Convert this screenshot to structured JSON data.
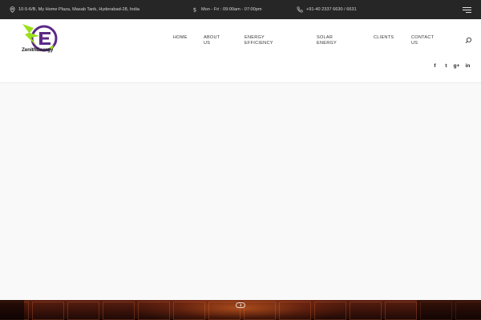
{
  "topbar": {
    "address": "10-5-6/B, My Home Plaza, Masab Tank, Hyderabad-28, India",
    "hours": "Mon - Fri : 09:00am - 07:00pm",
    "phone": "+91-40 2337 6630 / 6631",
    "icons": {
      "address": "map-pin-icon",
      "hours": "dollar-icon",
      "phone": "phone-icon",
      "menu": "hamburger-menu-icon"
    }
  },
  "brand": {
    "name": "ZenithEnergy",
    "colors": {
      "purple": "#5b2a86",
      "lime": "#9be01a"
    }
  },
  "nav": {
    "items": [
      {
        "line1": "HOME",
        "line2": ""
      },
      {
        "line1": "ABOUT",
        "line2": "US"
      },
      {
        "line1": "ENERGY",
        "line2": "EFFICIENCY"
      },
      {
        "line1": "SOLAR",
        "line2": "ENERGY"
      },
      {
        "line1": "CLIENTS",
        "line2": ""
      },
      {
        "line1": "CONTACT",
        "line2": "US"
      }
    ],
    "search_icon": "search-icon"
  },
  "social": {
    "facebook": "f",
    "twitter": "t",
    "googleplus": "g+",
    "linkedin": "in"
  },
  "colors": {
    "topbar_bg": "#262626",
    "main_bg": "#f9f9f9",
    "hero_tone": "#5a1f10"
  }
}
